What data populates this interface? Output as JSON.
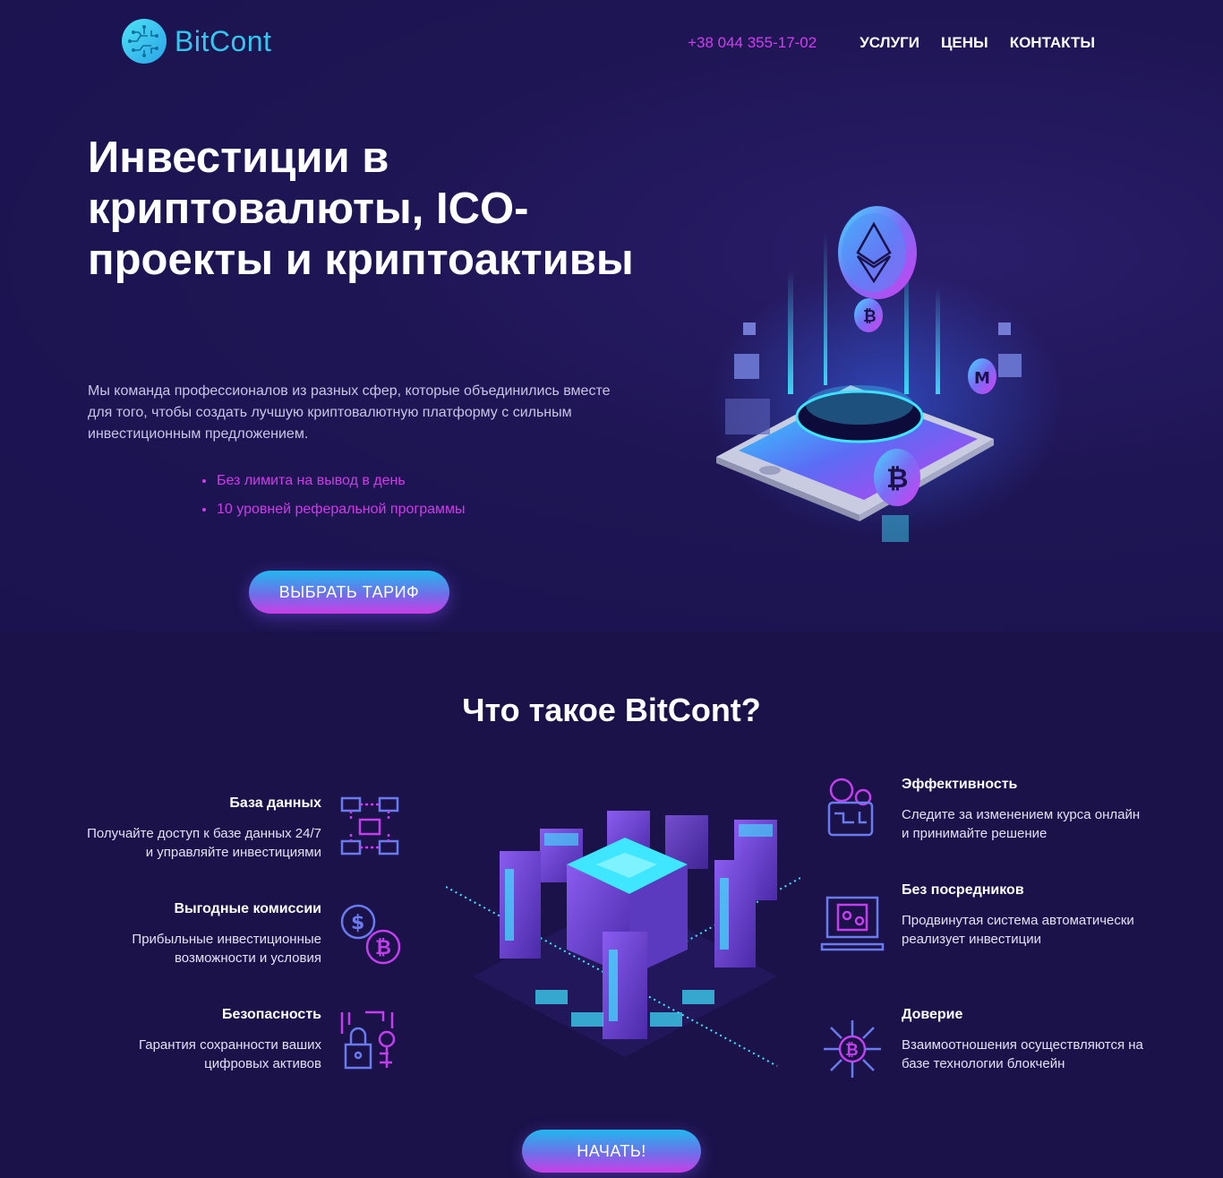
{
  "brand": {
    "name": "BitCont",
    "accent": "#34c7ee",
    "pink": "#d63bf0"
  },
  "header": {
    "phone": "+38 044 355-17-02",
    "nav": [
      "УСЛУГИ",
      "ЦЕНЫ",
      "КОНТАКТЫ"
    ]
  },
  "hero": {
    "title": "Инвестиции в криптовалюты, ICO-проекты и криптоактивы",
    "description": "Мы команда профессионалов из разных сфер, которые объединились вместе для того, чтобы создать лучшую криптовалютную платформу с сильным инвестиционным предложением.",
    "bullets": [
      "Без лимита на вывод в день",
      "10 уровней реферальной программы"
    ],
    "cta": "ВЫБРАТЬ ТАРИФ"
  },
  "about": {
    "title": "Что такое BitCont?",
    "left": [
      {
        "title": "База данных",
        "text": "Получайте доступ к базе данных 24/7 и управляйте инвестициями",
        "icon": "database-icon"
      },
      {
        "title": "Выгодные комиссии",
        "text": "Прибыльные инвестиционные возможности и условия",
        "icon": "coins-icon"
      },
      {
        "title": "Безопасность",
        "text": "Гарантия сохранности ваших цифровых активов",
        "icon": "lock-icon"
      }
    ],
    "right": [
      {
        "title": "Эффективность",
        "text": "Следите за изменением курса онлайн и принимайте решение",
        "icon": "wallet-icon"
      },
      {
        "title": "Без посредников",
        "text": "Продвинутая система автоматически реализует инвестиции",
        "icon": "laptop-exchange-icon"
      },
      {
        "title": "Доверие",
        "text": "Взаимоотношения осуществляются на базе технологии блокчейн",
        "icon": "blockchain-icon"
      }
    ],
    "cta": "НАЧАТЬ!"
  }
}
